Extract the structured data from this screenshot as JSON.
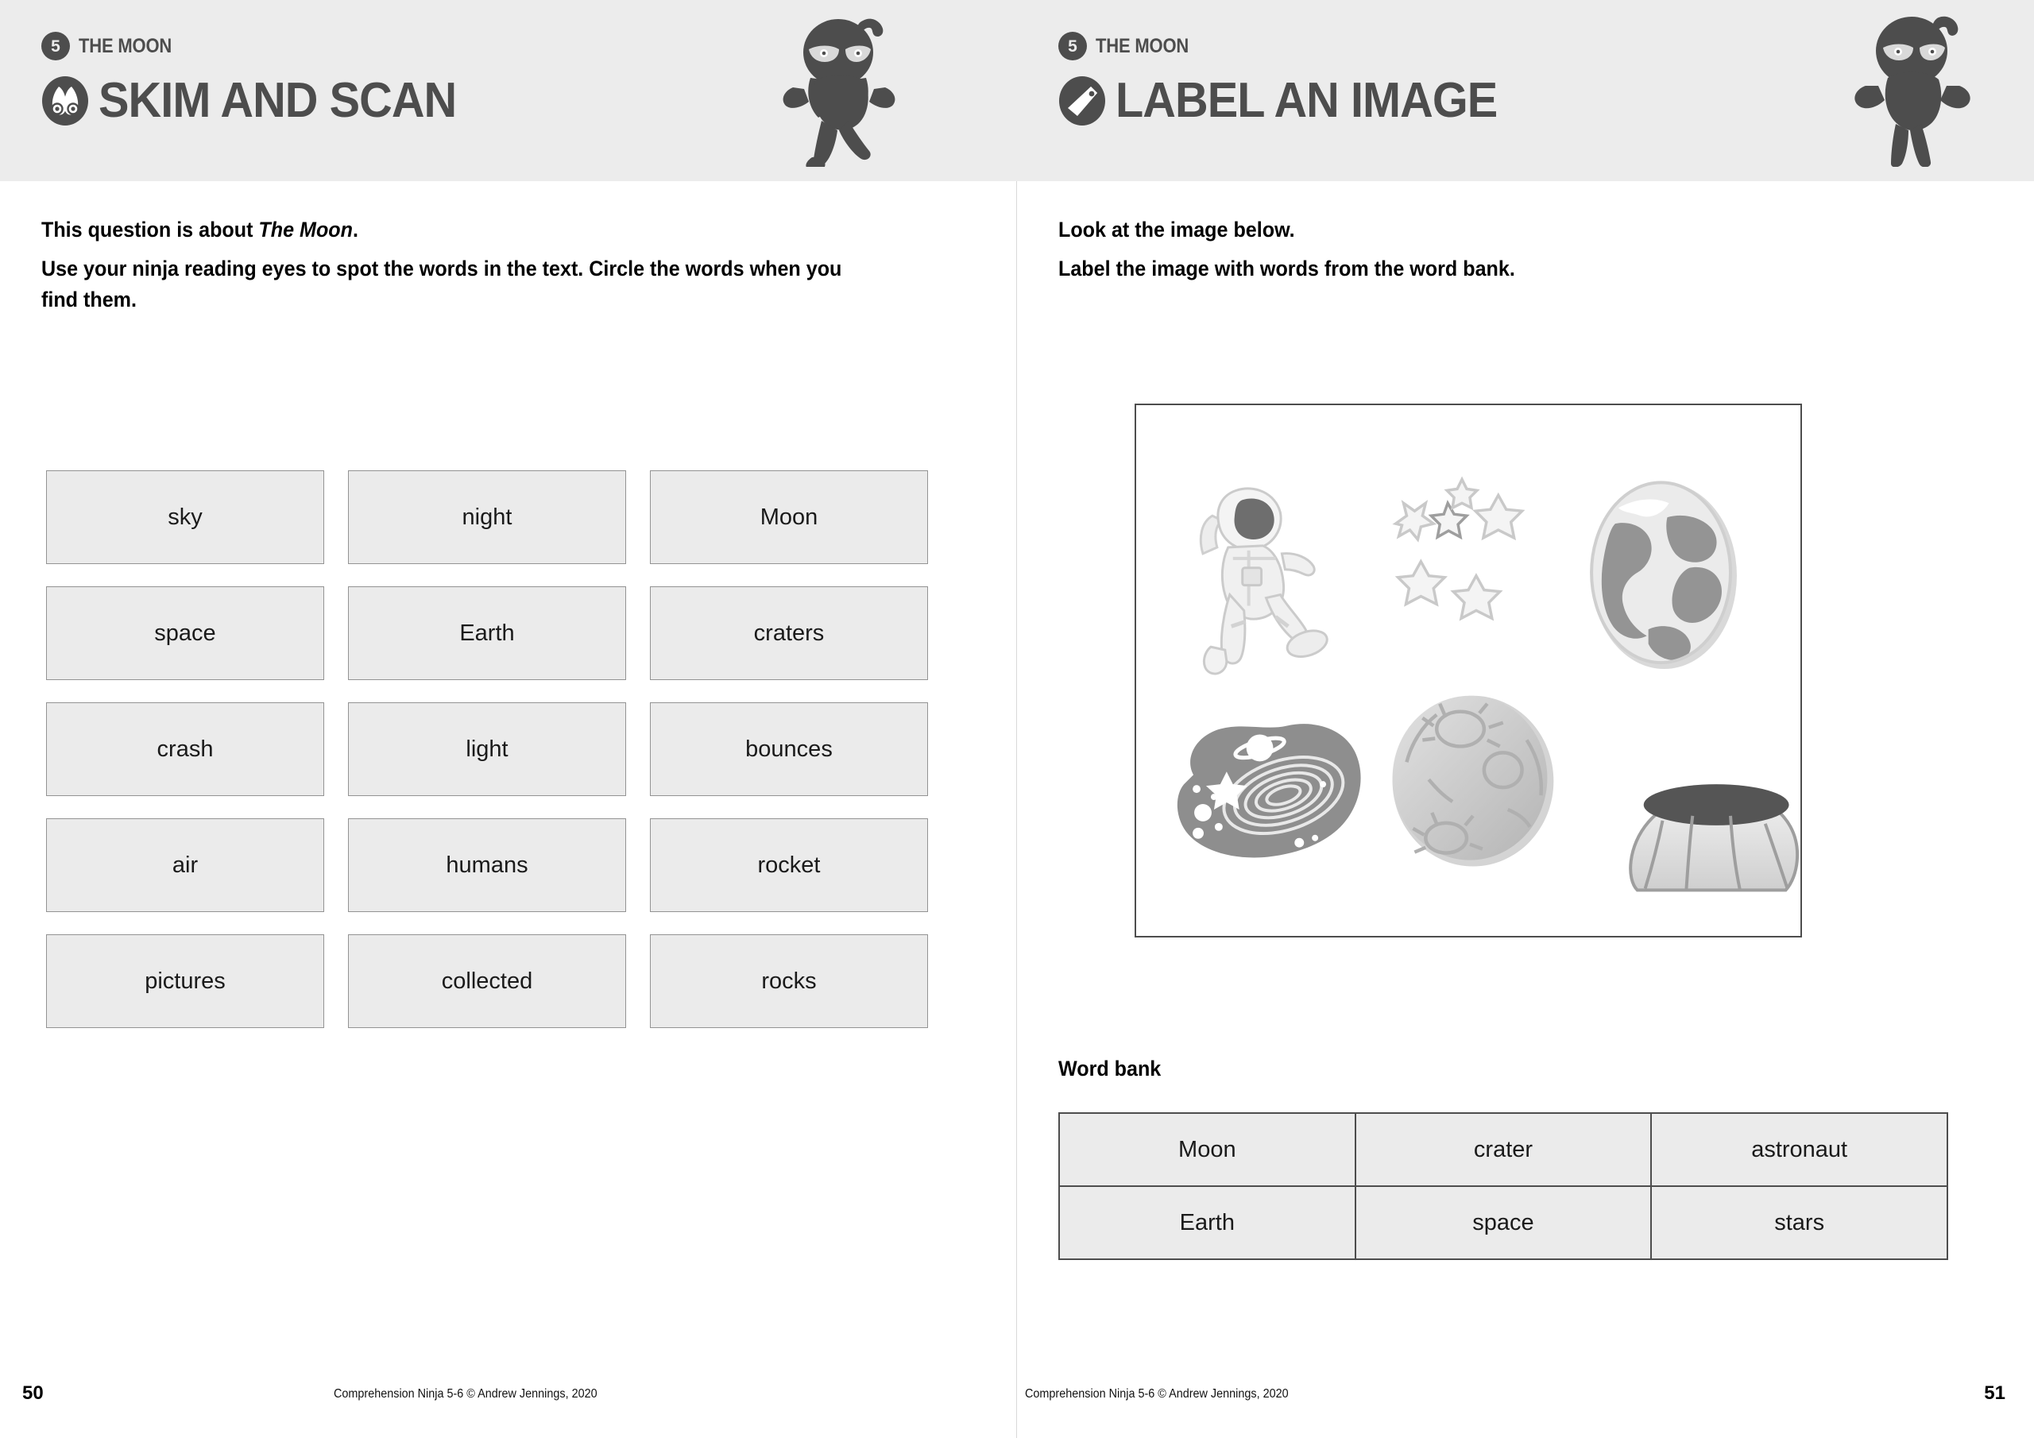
{
  "left_page": {
    "header": {
      "badge_number": "5",
      "kicker": "THE MOON",
      "title": "SKIM AND SCAN",
      "icon": "binoculars-icon",
      "mascot": "ninja-mascot"
    },
    "instructions": {
      "line1_prefix": "This question is about ",
      "line1_emphasis": "The Moon",
      "line1_suffix": ".",
      "line2": "Use your ninja reading eyes to spot the words in the text. Circle the words when you find them."
    },
    "word_grid": {
      "rows": [
        [
          "sky",
          "night",
          "Moon"
        ],
        [
          "space",
          "Earth",
          "craters"
        ],
        [
          "crash",
          "light",
          "bounces"
        ],
        [
          "air",
          "humans",
          "rocket"
        ],
        [
          "pictures",
          "collected",
          "rocks"
        ]
      ]
    },
    "footer": {
      "page_number": "50",
      "copyright": "Comprehension Ninja 5-6 © Andrew Jennings, 2020"
    }
  },
  "right_page": {
    "header": {
      "badge_number": "5",
      "kicker": "THE MOON",
      "title": "LABEL AN IMAGE",
      "icon": "tag-icon",
      "mascot": "ninja-mascot"
    },
    "instructions": {
      "line1": "Look at the image below.",
      "line2": "Label the image with words from the word bank."
    },
    "illustration": {
      "items": [
        "astronaut-illustration",
        "stars-illustration",
        "earth-globe-illustration",
        "space-galaxy-illustration",
        "moon-illustration",
        "crater-illustration"
      ]
    },
    "word_bank": {
      "title": "Word bank",
      "rows": [
        [
          "Moon",
          "crater",
          "astronaut"
        ],
        [
          "Earth",
          "space",
          "stars"
        ]
      ]
    },
    "footer": {
      "page_number": "51",
      "copyright": "Comprehension Ninja 5-6 © Andrew Jennings, 2020"
    }
  },
  "colors": {
    "header_band": "#ececec",
    "ink_dark": "#4d4d4d",
    "box_fill": "#ebebeb",
    "box_border": "#939393",
    "text": "#1a1a1a"
  }
}
